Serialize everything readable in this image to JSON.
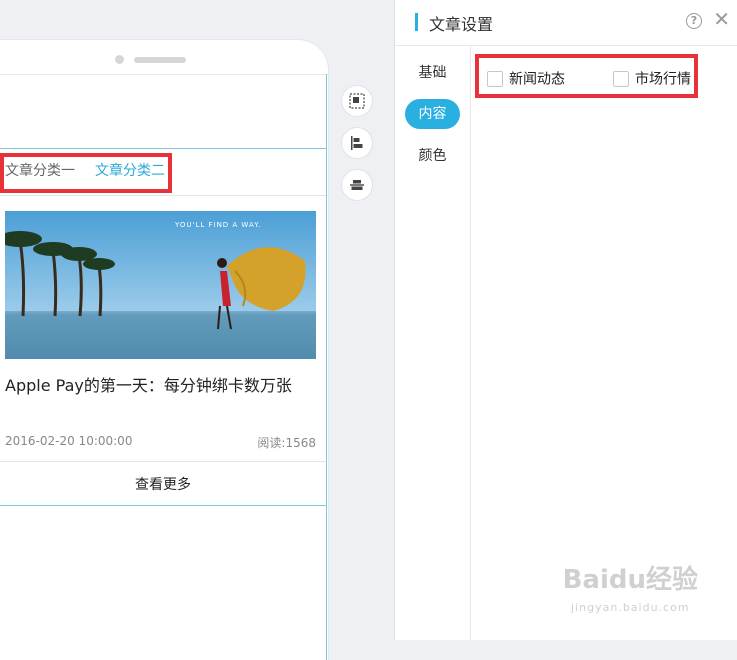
{
  "preview": {
    "category_tabs": [
      "文章分类一",
      "文章分类二"
    ],
    "article": {
      "image_caption": "YOU'LL FIND A WAY.",
      "title": "Apple Pay的第一天：每分钟绑卡数万张",
      "date": "2016-02-20 10:00:00",
      "reads": "阅读:1568"
    },
    "more_label": "查看更多"
  },
  "tools": {
    "icons": [
      "select-area-icon",
      "align-left-icon",
      "align-center-icon"
    ]
  },
  "panel": {
    "title": "文章设置",
    "help_glyph": "?",
    "close_glyph": "✕",
    "nav": [
      "基础",
      "内容",
      "颜色"
    ],
    "active_nav": "内容",
    "options": [
      {
        "label": "新闻动态",
        "checked": false
      },
      {
        "label": "市场行情",
        "checked": false
      }
    ]
  },
  "watermark": {
    "text": "Baidu经验",
    "url": "jingyan.baidu.com"
  },
  "colors": {
    "accent": "#2ab0e0",
    "highlight_box": "#e8323a"
  }
}
